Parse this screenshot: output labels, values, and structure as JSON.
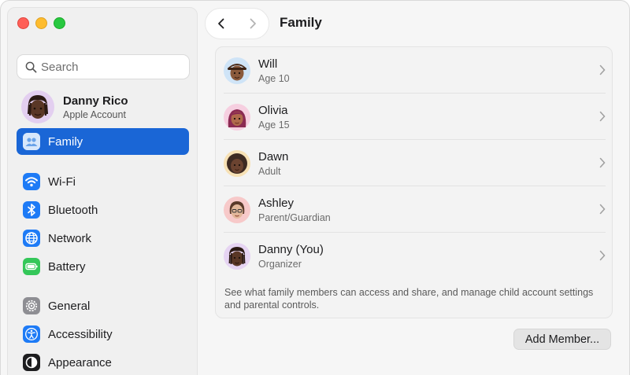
{
  "window": {
    "title": "Family"
  },
  "search": {
    "placeholder": "Search"
  },
  "account": {
    "name": "Danny Rico",
    "subtitle": "Apple Account"
  },
  "sidebar": {
    "items": [
      {
        "label": "Family",
        "icon": "family-icon",
        "color": "#5ea0f0",
        "selected": true
      },
      {
        "label": "Wi-Fi",
        "icon": "wifi-icon",
        "color": "#1e7bf6"
      },
      {
        "label": "Bluetooth",
        "icon": "bluetooth-icon",
        "color": "#1e7bf6"
      },
      {
        "label": "Network",
        "icon": "globe-icon",
        "color": "#1e7bf6"
      },
      {
        "label": "Battery",
        "icon": "battery-icon",
        "color": "#34c759"
      },
      {
        "label": "General",
        "icon": "gear-icon",
        "color": "#8e8e93"
      },
      {
        "label": "Accessibility",
        "icon": "accessibility-icon",
        "color": "#1e7bf6"
      },
      {
        "label": "Appearance",
        "icon": "appearance-icon",
        "color": "#1d1d1f"
      }
    ]
  },
  "main": {
    "title": "Family",
    "members": [
      {
        "name": "Will",
        "role": "Age 10",
        "avatar_bg": "#cfe4f7"
      },
      {
        "name": "Olivia",
        "role": "Age 15",
        "avatar_bg": "#f6cfe0"
      },
      {
        "name": "Dawn",
        "role": "Adult",
        "avatar_bg": "#f7e1b5"
      },
      {
        "name": "Ashley",
        "role": "Parent/Guardian",
        "avatar_bg": "#f7c9c9"
      },
      {
        "name": "Danny (You)",
        "role": "Organizer",
        "avatar_bg": "#e6d4f2"
      }
    ],
    "footnote": "See what family members can access and share, and manage child account settings and parental controls.",
    "add_member_label": "Add Member..."
  },
  "colors": {
    "accent": "#1a66d6"
  }
}
